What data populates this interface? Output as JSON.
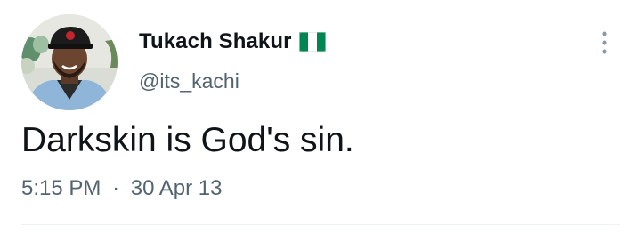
{
  "tweet": {
    "author": {
      "display_name": "Tukach Shakur",
      "handle": "@its_kachi",
      "avatar_icon": "profile-photo",
      "flag_icon": "nigeria-flag-icon"
    },
    "text": "Darkskin is God's sin.",
    "time": "5:15 PM",
    "separator": "·",
    "date": "30 Apr 13"
  },
  "colors": {
    "text_primary": "#0f1419",
    "text_secondary": "#536471",
    "divider": "#eff3f4",
    "flag_green": "#008751",
    "flag_white": "#ffffff"
  }
}
